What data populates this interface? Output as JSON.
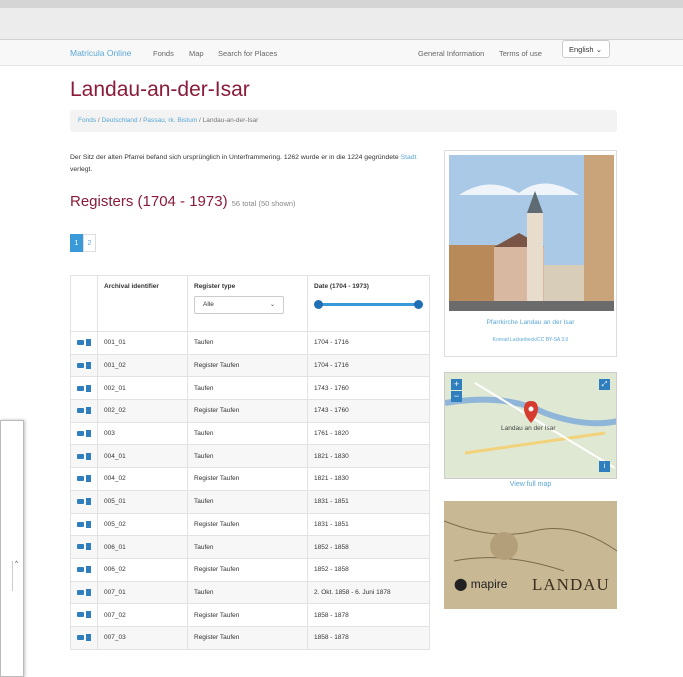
{
  "nav": {
    "brand": "Matricula Online",
    "links": [
      "Fonds",
      "Map",
      "Search for Places"
    ],
    "right_links": [
      "General Information",
      "Terms of use"
    ],
    "language": "English"
  },
  "page": {
    "title": "Landau-an-der-Isar",
    "breadcrumb": [
      "Fonds",
      "Deutschland",
      "Passau, rk. Bistum",
      "Landau-an-der-Isar"
    ],
    "description_before": "Der Sitz der alten Pfarrei befand sich ursprünglich in Unterframmering. 1262 wurde er in die 1224 gegründete ",
    "description_link": "Stadt",
    "description_after": " verlegt.",
    "registers_title": "Registers (1704 - 1973)",
    "registers_count": "56 total (50 shown)",
    "pages": [
      "1",
      "2"
    ]
  },
  "table": {
    "headers": [
      "Archival identifier",
      "Register type",
      "Date (1704 - 1973)"
    ],
    "filter_value": "Alle",
    "rows": [
      [
        "001_01",
        "Taufen",
        "1704 - 1716"
      ],
      [
        "001_02",
        "Register Taufen",
        "1704 - 1716"
      ],
      [
        "002_01",
        "Taufen",
        "1743 - 1760"
      ],
      [
        "002_02",
        "Register Taufen",
        "1743 - 1760"
      ],
      [
        "003",
        "Taufen",
        "1761 - 1820"
      ],
      [
        "004_01",
        "Taufen",
        "1821 - 1830"
      ],
      [
        "004_02",
        "Register Taufen",
        "1821 - 1830"
      ],
      [
        "005_01",
        "Taufen",
        "1831 - 1851"
      ],
      [
        "005_02",
        "Register Taufen",
        "1831 - 1851"
      ],
      [
        "006_01",
        "Taufen",
        "1852 - 1858"
      ],
      [
        "006_02",
        "Register Taufen",
        "1852 - 1858"
      ],
      [
        "007_01",
        "Taufen",
        "2. Okt. 1858 - 6. Juni 1878"
      ],
      [
        "007_02",
        "Register Taufen",
        "1858 - 1878"
      ],
      [
        "007_03",
        "Register Taufen",
        "1858 - 1878"
      ]
    ]
  },
  "sidebar": {
    "photo_caption": "Pfarrkirche Landau an der Isar",
    "photo_credit": "Konrad Lackerbeck/CC BY-SA 3.0",
    "map_label": "Landau an der Isar",
    "map_link": "View full map",
    "oldmap_brand": "mapire",
    "oldmap_text": "LANDAU"
  },
  "colors": {
    "accent": "#5aa7d6",
    "title": "#8a1c3a",
    "primary": "#3a9ad9"
  }
}
